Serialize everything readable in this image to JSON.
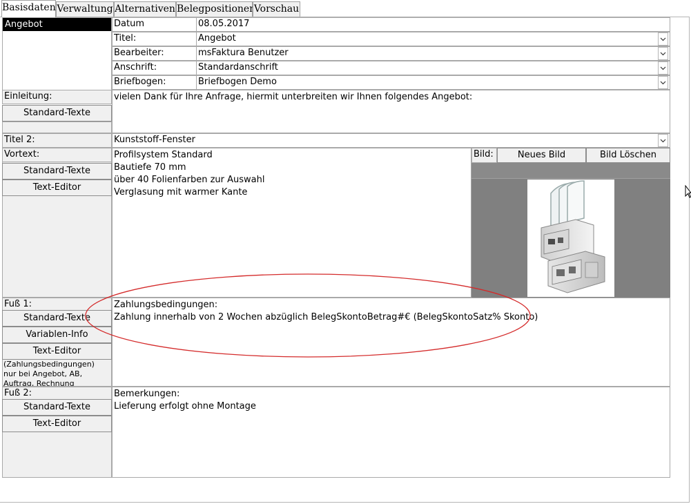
{
  "tabs": [
    "Basisdaten",
    "Verwaltung",
    "Alternativen",
    "Belegpositionen",
    "Vorschau"
  ],
  "active_tab": "Basisdaten",
  "doc_type": "Angebot",
  "header": {
    "datum_label": "Datum",
    "datum_value": "08.05.2017",
    "titel_label": "Titel:",
    "titel_value": "Angebot",
    "bearbeiter_label": "Bearbeiter:",
    "bearbeiter_value": "msFaktura Benutzer",
    "anschrift_label": "Anschrift:",
    "anschrift_value": "Standardanschrift",
    "briefbogen_label": "Briefbogen:",
    "briefbogen_value": "Briefbogen Demo"
  },
  "einleitung": {
    "label": "Einleitung:",
    "button": "Standard-Texte",
    "text": "vielen Dank für Ihre Anfrage,  hiermit unterbreiten wir Ihnen folgendes Angebot:"
  },
  "titel2": {
    "label": "Titel 2:",
    "value": "Kunststoff-Fenster"
  },
  "vortext": {
    "label": "Vortext:",
    "button1": "Standard-Texte",
    "button2": "Text-Editor",
    "text": "Profilsystem Standard\nBautiefe 70 mm\nüber 40 Folienfarben zur Auswahl\nVerglasung mit warmer Kante"
  },
  "bild": {
    "label": "Bild:",
    "new_button": "Neues Bild",
    "delete_button": "Bild Löschen"
  },
  "fuss1": {
    "label": "Fuß 1:",
    "button1": "Standard-Texte",
    "button2": "Variablen-Info",
    "button3": "Text-Editor",
    "hint": "(Zahlungsbedingungen)\nnur bei Angebot, AB,\nAuftrag, Rechnung",
    "text": "Zahlungsbedingungen:\nZahlung innerhalb von 2 Wochen abzüglich BelegSkontoBetrag#€ (BelegSkontoSatz% Skonto)"
  },
  "fuss2": {
    "label": "Fuß 2:",
    "button1": "Standard-Texte",
    "button2": "Text-Editor",
    "text": "Bemerkungen:\nLieferung erfolgt ohne Montage"
  },
  "colors": {
    "tab_bg": "#f0f0f0",
    "button_bg": "#f0f0f0",
    "selected_bg": "#000000",
    "annotation": "#d42a2a",
    "image_gray": "#808080"
  }
}
